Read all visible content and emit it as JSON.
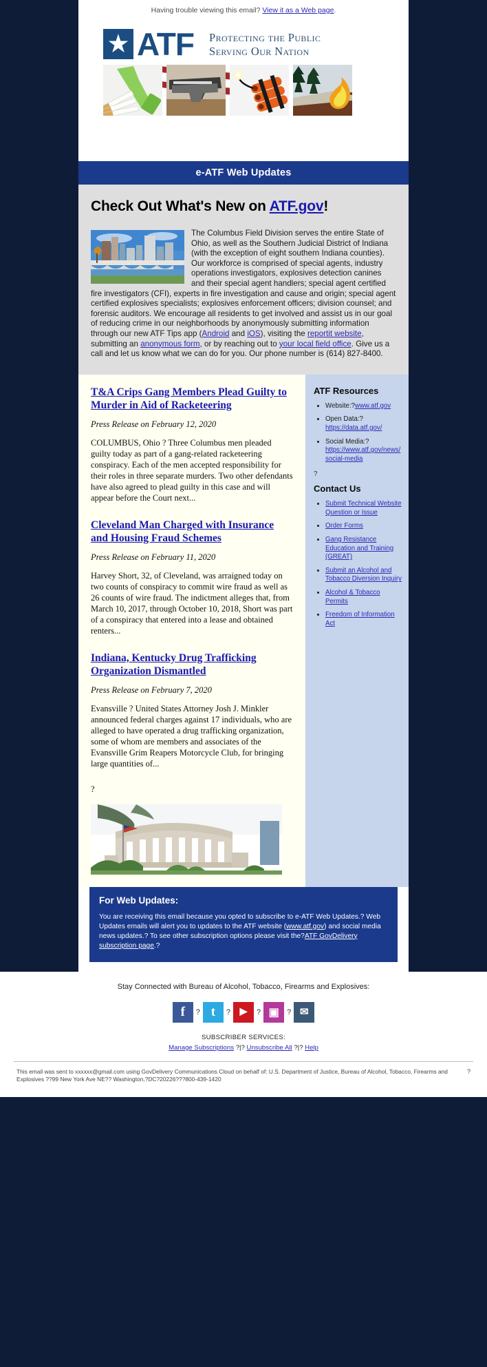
{
  "preheader": {
    "text_before": "Having trouble viewing this email? ",
    "link": "View it as a Web page",
    "text_after": "."
  },
  "banner": {
    "logo_text": "ATF",
    "star_icon": "star-icon",
    "tagline_line1": "Protecting the Public",
    "tagline_line2": "Serving Our Nation",
    "photos": [
      {
        "name": "alcohol-tobacco-photo",
        "alt": "bottle and cigarettes"
      },
      {
        "name": "firearms-photo",
        "alt": "handguns"
      },
      {
        "name": "explosives-photo",
        "alt": "lit dynamite"
      },
      {
        "name": "arson-photo",
        "alt": "house fire"
      }
    ]
  },
  "title_bar": {
    "label": "e-ATF Web Updates"
  },
  "intro": {
    "headline_before": "Check Out What's New on ",
    "headline_link": "ATF.gov",
    "headline_after": "!",
    "image_name": "columbus-skyline-photo",
    "p1": "The Columbus Field Division serves the entire State of Ohio, as well as the Southern Judicial District of Indiana (with the exception of eight southern Indiana counties). Our workforce is comprised of special agents, industry operations investigators, explosives detection canines and their special agent handlers; special agent certified fire investigators (CFI), experts in fire investigation and cause and origin; special agent certified explosives specialists; explosives enforcement officers; division counsel; and forensic auditors. We encourage all residents to get involved and assist us in our goal of reducing crime in our neighborhoods by anonymously submitting information through our new ATF Tips app (",
    "link_android": "Android",
    "p2": " and ",
    "link_ios": "iOS",
    "p3": "), visiting the ",
    "link_reportit": "reportit website",
    "p4": ", submitting an ",
    "link_anon": "anonymous form",
    "p5": ", or by reaching out to ",
    "link_field_office": "your local field office",
    "p6": ". Give us a call and let us know what we can do for you. Our phone number is (614) 827-8400."
  },
  "articles": [
    {
      "title": "T&A Crips Gang Members Plead Guilty to Murder in Aid of Racketeering",
      "meta": "Press Release on February 12, 2020",
      "body": "COLUMBUS, Ohio ? Three Columbus men pleaded guilty today as part of a gang-related racketeering conspiracy. Each of the men accepted responsibility for their roles in three separate murders. Two other defendants have also agreed to plead guilty in this case and will appear before the Court next..."
    },
    {
      "title": "Cleveland Man Charged with Insurance and Housing Fraud Schemes",
      "meta": "Press Release on February 11, 2020",
      "body": "Harvey Short, 32, of Cleveland, was arraigned today on two counts of conspiracy to commit wire fraud as well as 26 counts of wire fraud. The indictment alleges that, from March 10, 2017, through October 10, 2018, Short was part of a conspiracy that entered into a lease and obtained renters..."
    },
    {
      "title": "Indiana, Kentucky Drug Trafficking Organization Dismantled",
      "meta": "Press Release on February 7, 2020",
      "body": "Evansville ? United States Attorney Josh J. Minkler announced federal charges against 17 individuals, who are alleged to have operated a drug trafficking organization, some of whom are members and associates of the Evansville Grim Reapers Motorcycle Club, for bringing large quantities of..."
    }
  ],
  "main_trailing_qmark": "?",
  "bottom_image_name": "atf-headquarters-photo",
  "sidebar": {
    "resources_heading": "ATF Resources",
    "resources": [
      {
        "label": "Website:?",
        "link": "www.atf.gov"
      },
      {
        "label": "Open Data:?",
        "link": "https://data.atf.gov/"
      },
      {
        "label": "Social Media:?",
        "link": "https://www.atf.gov/news/social-media"
      }
    ],
    "separator_qmark": "?",
    "contact_heading": "Contact Us",
    "contact_links": [
      "Submit Technical Website Question or Issue",
      "Order Forms",
      "Gang Resistance Education and Training (GREAT)",
      "Submit an Alcohol and Tobacco Diversion Inquiry",
      "Alcohol & Tobacco Permits",
      "Freedom of Information Act"
    ]
  },
  "notice": {
    "heading": "For Web Updates:",
    "t1": "You are receiving this email because you opted to subscribe to e-ATF Web Updates.? Web Updates emails will alert you to updates to the ATF website (",
    "link_atf": "www.atf.gov",
    "t2": ") and social media news updates.? To see other subscription options please visit the?",
    "link_gd": "ATF GovDelivery subscription page",
    "t3": ".?"
  },
  "footer": {
    "connect_text": "Stay Connected with Bureau of Alcohol, Tobacco, Firearms and Explosives:",
    "social": [
      {
        "name": "facebook-icon",
        "glyph": "f",
        "color": "#3b5998"
      },
      {
        "name": "twitter-icon",
        "glyph": "t",
        "color": "#2daae1"
      },
      {
        "name": "youtube-icon",
        "glyph": "▶",
        "color": "#cc181e"
      },
      {
        "name": "instagram-icon",
        "glyph": "▣",
        "color": "#b3399a"
      },
      {
        "name": "email-icon",
        "glyph": "✉",
        "color": "#3b5a75"
      }
    ],
    "social_sep": "?",
    "subscriber_services_label": "SUBSCRIBER SERVICES:",
    "manage_link": "Manage Subscriptions",
    "sep1": " ?|? ",
    "unsub_link": "Unsubscribe All",
    "sep2": " ?|? ",
    "help_link": "Help",
    "legal_text": "This email was sent to xxxxxx@gmail.com using GovDelivery Communications Cloud on behalf of: U.S. Department of Justice, Bureau of Alcohol, Tobacco, Firearms and Explosives ??99 New York Ave NE?? Washington,?DC?20226???800-439-1420",
    "legal_qmark": "?"
  },
  "colors": {
    "outer_bg": "#0e1c38",
    "brand_blue": "#1b3a8c",
    "logo_blue": "#1b4d81",
    "link_blue": "#2a2ab5",
    "sidebar_bg": "#c6d4ec",
    "intro_bg": "#dedede",
    "swoosh_red": "#a02a2a"
  }
}
